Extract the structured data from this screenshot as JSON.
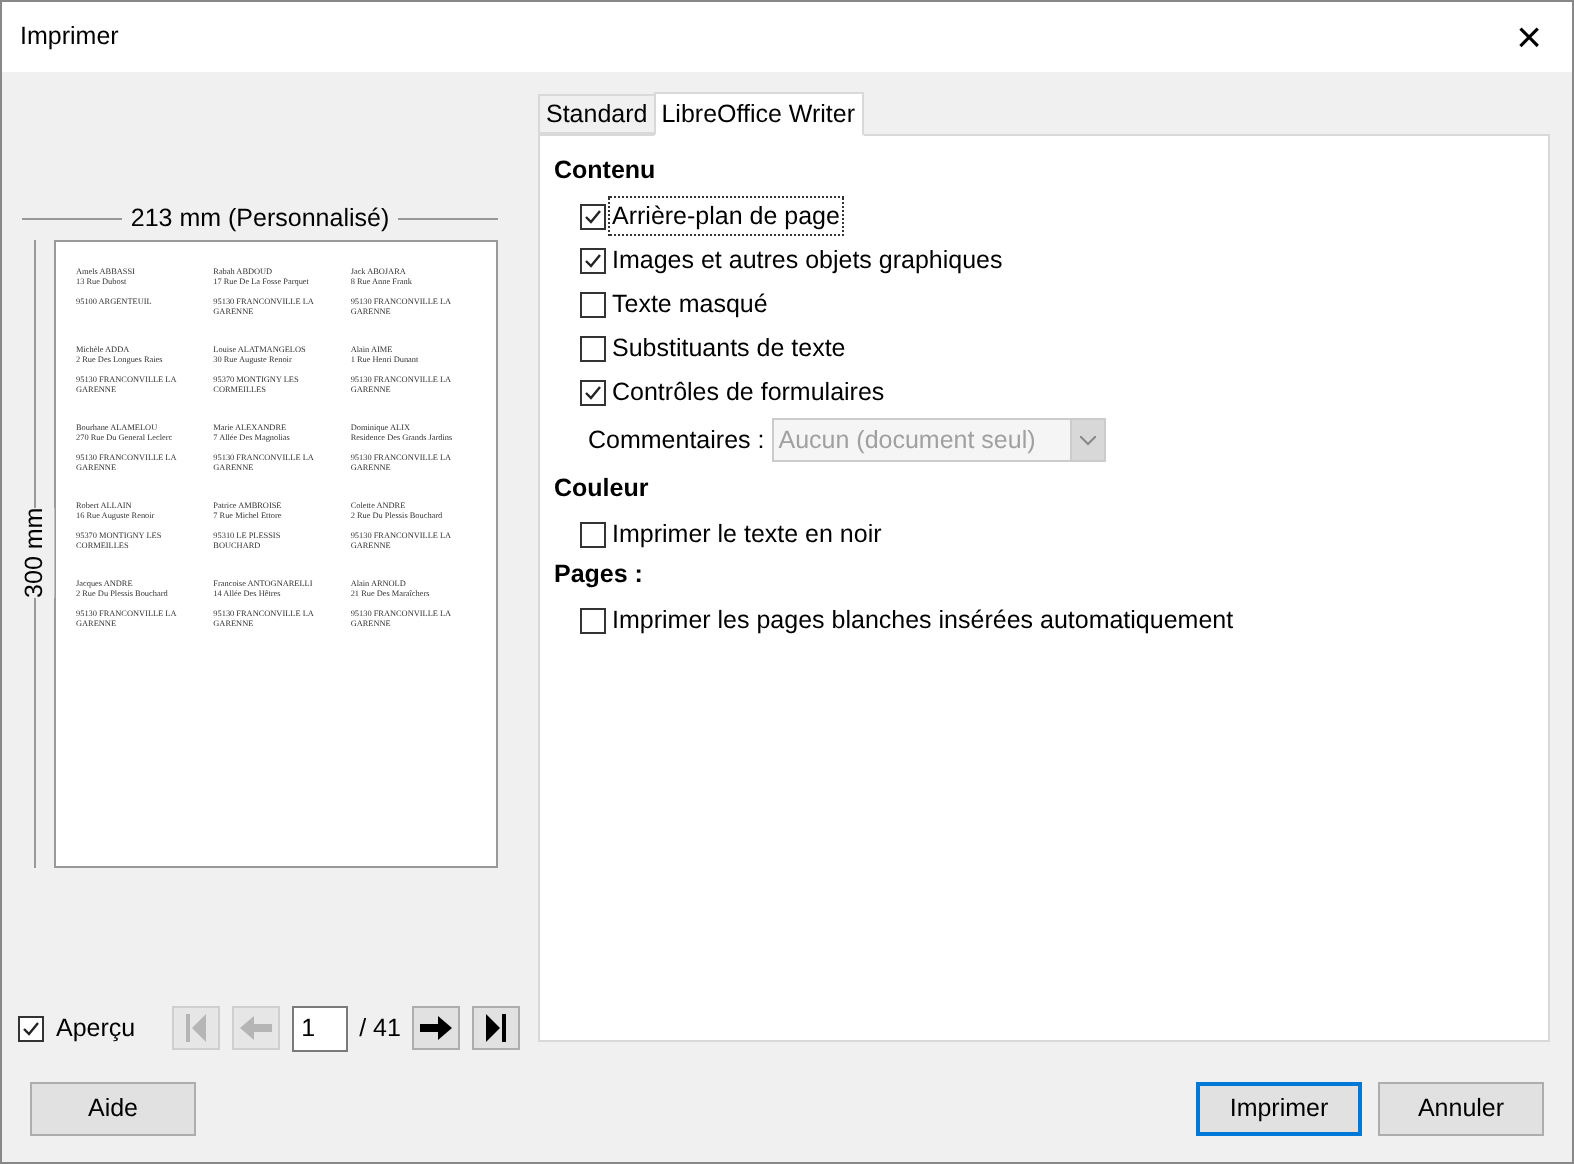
{
  "window": {
    "title": "Imprimer",
    "close": "×"
  },
  "preview": {
    "width_label": "213 mm (Personnalisé)",
    "height_label": "300 mm",
    "labels": [
      {
        "name": "Amels ABBASSI",
        "street": "13 Rue Dubost",
        "city": "95100 ARGENTEUIL"
      },
      {
        "name": "Rabah ABDOUD",
        "street": "17 Rue De La Fosse Parquet",
        "city": "95130 FRANCONVILLE LA GARENNE"
      },
      {
        "name": "Jack ABOJARA",
        "street": "8 Rue Anne Frank",
        "city": "95130 FRANCONVILLE LA GARENNE"
      },
      {
        "name": "Michèle ADDA",
        "street": "2 Rue Des Longues Raies",
        "city": "95130 FRANCONVILLE LA GARENNE"
      },
      {
        "name": "Louise ALATMANGELOS",
        "street": "30 Rue Auguste Renoir",
        "city": "95370 MONTIGNY LES CORMEILLES"
      },
      {
        "name": "Alain AIME",
        "street": "1 Rue Henri Dunant",
        "city": "95130 FRANCONVILLE LA GARENNE"
      },
      {
        "name": "Bourhane ALAMELOU",
        "street": "270 Rue Du General Leclerc",
        "city": "95130 FRANCONVILLE LA GARENNE"
      },
      {
        "name": "Marie ALEXANDRE",
        "street": "7 Allée Des Magnolias",
        "city": "95130 FRANCONVILLE LA GARENNE"
      },
      {
        "name": "Dominique ALIX",
        "street": "Residence Des Grands Jardins",
        "city": "95130 FRANCONVILLE LA GARENNE"
      },
      {
        "name": "Robert ALLAIN",
        "street": "16 Rue Auguste Renoir",
        "city": "95370 MONTIGNY LES CORMEILLES"
      },
      {
        "name": "Patrice AMBROISE",
        "street": "7 Rue Michel Ettore",
        "city": "95310 LE PLESSIS BOUCHARD"
      },
      {
        "name": "Colette ANDRE",
        "street": "2 Rue Du Plessis Bouchard",
        "city": "95130 FRANCONVILLE LA GARENNE"
      },
      {
        "name": "Jacques ANDRE",
        "street": "2 Rue Du Plessis Bouchard",
        "city": "95130 FRANCONVILLE LA GARENNE"
      },
      {
        "name": "Francoise ANTOGNARELLI",
        "street": "14 Allée Des Hêtres",
        "city": "95130 FRANCONVILLE LA GARENNE"
      },
      {
        "name": "Alain ARNOLD",
        "street": "21 Rue Des Maraîchers",
        "city": "95130 FRANCONVILLE LA GARENNE"
      }
    ]
  },
  "preview_toggle": {
    "label": "Aperçu",
    "checked": true
  },
  "pager": {
    "page": "1",
    "total": "/ 41",
    "first_disabled": true,
    "prev_disabled": true,
    "next_disabled": false,
    "last_disabled": false
  },
  "tabs": [
    {
      "label": "Standard",
      "selected": false
    },
    {
      "label": "LibreOffice Writer",
      "selected": true
    }
  ],
  "sections": [
    {
      "heading": "Contenu",
      "items": [
        {
          "kind": "checkbox",
          "label": "Arrière-plan de page",
          "checked": true,
          "focused": true
        },
        {
          "kind": "checkbox",
          "label": "Images et autres objets graphiques",
          "checked": true,
          "focused": false
        },
        {
          "kind": "checkbox",
          "label": "Texte masqué",
          "checked": false,
          "focused": false
        },
        {
          "kind": "checkbox",
          "label": "Substituants de texte",
          "checked": false,
          "focused": false
        },
        {
          "kind": "checkbox",
          "label": "Contrôles de formulaires",
          "checked": true,
          "focused": false
        },
        {
          "kind": "combo",
          "label": "Commentaires :",
          "value": "Aucun (document seul)",
          "disabled": true
        }
      ]
    },
    {
      "heading": "Couleur",
      "items": [
        {
          "kind": "checkbox",
          "label": "Imprimer le texte en noir",
          "checked": false,
          "focused": false
        }
      ]
    },
    {
      "heading": "Pages :",
      "items": [
        {
          "kind": "checkbox",
          "label": "Imprimer les pages blanches insérées automatiquement",
          "checked": false,
          "focused": false
        }
      ]
    }
  ],
  "buttons": [
    {
      "label": "Aide",
      "primary": false
    },
    {
      "label": "Imprimer",
      "primary": true
    },
    {
      "label": "Annuler",
      "primary": false
    }
  ]
}
